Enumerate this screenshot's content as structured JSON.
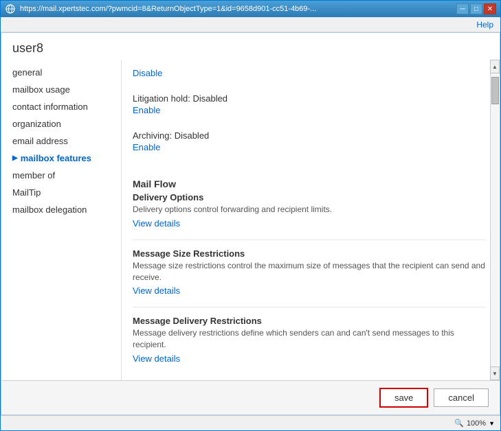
{
  "window": {
    "url": "https://mail.xpertstec.com/?pwmcid=8&ReturnObjectType=1&id=9658d901-cc51-4b69-...",
    "title_controls": {
      "minimize": "─",
      "maximize": "□",
      "close": "✕"
    }
  },
  "help_bar": {
    "help_label": "Help"
  },
  "user": {
    "name": "user8"
  },
  "sidebar": {
    "items": [
      {
        "id": "general",
        "label": "general",
        "active": false
      },
      {
        "id": "mailbox-usage",
        "label": "mailbox usage",
        "active": false
      },
      {
        "id": "contact-information",
        "label": "contact information",
        "active": false
      },
      {
        "id": "organization",
        "label": "organization",
        "active": false
      },
      {
        "id": "email-address",
        "label": "email address",
        "active": false
      },
      {
        "id": "mailbox-features",
        "label": "mailbox features",
        "active": true
      },
      {
        "id": "member-of",
        "label": "member of",
        "active": false
      },
      {
        "id": "mailtip",
        "label": "MailTip",
        "active": false
      },
      {
        "id": "mailbox-delegation",
        "label": "mailbox delegation",
        "active": false
      }
    ]
  },
  "content": {
    "disable_label": "Disable",
    "litigation_status": "Litigation hold: Disabled",
    "litigation_enable": "Enable",
    "archiving_status": "Archiving: Disabled",
    "archiving_enable": "Enable",
    "mail_flow_header": "Mail Flow",
    "delivery_options_title": "Delivery Options",
    "delivery_options_desc": "Delivery options control forwarding and recipient limits.",
    "delivery_view_details": "View details",
    "message_size_title": "Message Size Restrictions",
    "message_size_desc": "Message size restrictions control the maximum size of messages that the recipient can send and receive.",
    "message_size_view_details": "View details",
    "message_delivery_title": "Message Delivery Restrictions",
    "message_delivery_desc": "Message delivery restrictions define which senders can and can't send messages to this recipient.",
    "message_delivery_view_details": "View details"
  },
  "footer": {
    "save_label": "save",
    "cancel_label": "cancel"
  },
  "status_bar": {
    "zoom": "100%"
  }
}
